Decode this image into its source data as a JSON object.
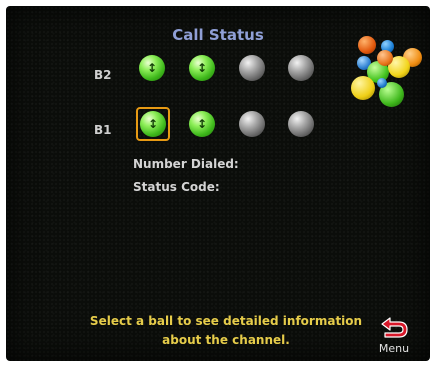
{
  "screen": {
    "title": "Call Status",
    "rows": [
      {
        "label": "B2",
        "balls": [
          {
            "state": "green",
            "icon": "up-down-arrow-icon",
            "glyph": "↕"
          },
          {
            "state": "green",
            "icon": "up-down-arrow-icon",
            "glyph": "↕"
          },
          {
            "state": "gray"
          },
          {
            "state": "gray"
          }
        ]
      },
      {
        "label": "B1",
        "selected_index": 0,
        "balls": [
          {
            "state": "green",
            "icon": "up-down-arrow-icon",
            "glyph": "↕"
          },
          {
            "state": "green",
            "icon": "up-down-arrow-icon",
            "glyph": "↕"
          },
          {
            "state": "gray"
          },
          {
            "state": "gray"
          }
        ]
      }
    ],
    "details": {
      "number_dialed_label": "Number Dialed:",
      "status_code_label": "Status Code:"
    },
    "hint_line1": "Select a ball to see detailed information",
    "hint_line2": "about the channel.",
    "menu_label": "Menu",
    "colors": {
      "title": "#8f9fd6",
      "hint": "#e6cc4a",
      "selection": "#e79a14",
      "active_ball": "#3eb81b",
      "menu_arrow": "#d8182a"
    }
  }
}
